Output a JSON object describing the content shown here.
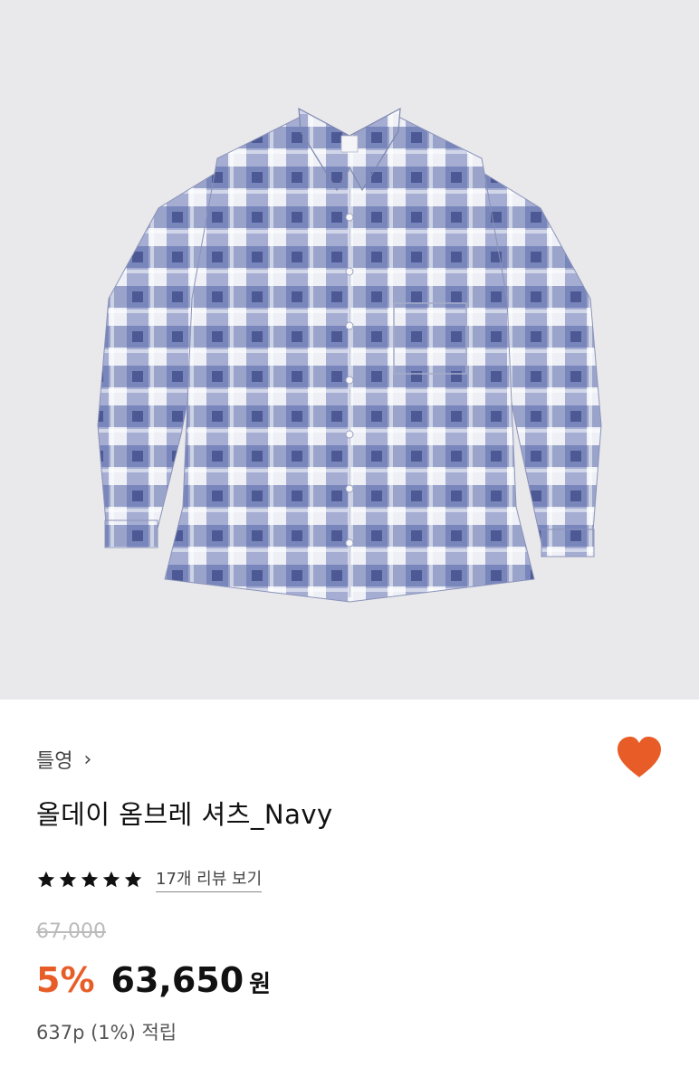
{
  "product": {
    "image_alt": "Navy ombre check shirt",
    "brand": "틀영",
    "brand_chevron": "›",
    "title": "올데이 옴브레 셔츠_Navy",
    "rating_stars": 5,
    "review_link": "17개 리뷰 보기",
    "original_price": "67,000",
    "discount": "5%",
    "price": "63,650",
    "currency": "원",
    "points": "637p (1%) 적립",
    "wishlist_icon": "heart-icon"
  },
  "colors": {
    "accent": "#e85d27",
    "heart": "#e85d27",
    "hero_bg": "#e9e9ec",
    "shirt_navy": "#4a5a9e",
    "shirt_light": "#f2f2f5"
  }
}
